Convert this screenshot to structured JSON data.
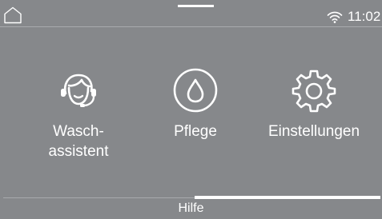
{
  "status_bar": {
    "time": "11:02",
    "home_icon": "home-icon",
    "wifi_icon": "wifi-icon"
  },
  "tiles": [
    {
      "label": "Wasch-\nassistent",
      "icon": "headset-assistant-icon"
    },
    {
      "label": "Pflege",
      "icon": "water-drop-icon"
    },
    {
      "label": "Einstellungen",
      "icon": "gear-icon"
    }
  ],
  "help": {
    "label": "Hilfe"
  },
  "scroll_indicator": {
    "fraction": 0.5
  },
  "colors": {
    "background": "#86888b",
    "foreground": "#ffffff",
    "divider": "#a8aaad"
  }
}
